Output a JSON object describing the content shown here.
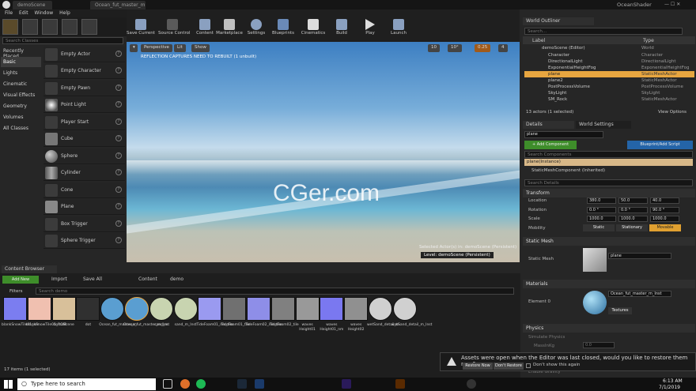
{
  "window": {
    "tabs": [
      "demoScene",
      "Ocean_fut_master_m"
    ],
    "app_name": "OceanShader"
  },
  "menu": [
    "File",
    "Edit",
    "Window",
    "Help"
  ],
  "modes": {
    "search_placeholder": "Search Classes",
    "categories": [
      "Recently Placed",
      "Basic",
      "Lights",
      "Cinematic",
      "Visual Effects",
      "Geometry",
      "Volumes",
      "All Classes"
    ],
    "selected": "Basic",
    "actors": [
      "Empty Actor",
      "Empty Character",
      "Empty Pawn",
      "Point Light",
      "Player Start",
      "Cube",
      "Sphere",
      "Cylinder",
      "Cone",
      "Plane",
      "Box Trigger",
      "Sphere Trigger"
    ]
  },
  "toolbar": [
    {
      "label": "Save Current",
      "icon": "save-icon"
    },
    {
      "label": "Source Control",
      "icon": "source-control-icon"
    },
    {
      "label": "Content",
      "icon": "content-icon"
    },
    {
      "label": "Marketplace",
      "icon": "marketplace-icon"
    },
    {
      "label": "Settings",
      "icon": "settings-icon"
    },
    {
      "label": "Blueprints",
      "icon": "blueprints-icon"
    },
    {
      "label": "Cinematics",
      "icon": "cinematics-icon"
    },
    {
      "label": "Build",
      "icon": "build-icon"
    },
    {
      "label": "Play",
      "icon": "play-icon"
    },
    {
      "label": "Launch",
      "icon": "launch-icon"
    }
  ],
  "viewport": {
    "perspective": "Perspective",
    "lit": "Lit",
    "show": "Show",
    "warning": "REFLECTION CAPTURES NEED TO REBUILT (1 unbuilt)",
    "snap": [
      "10",
      "10°",
      "0.25",
      "4"
    ],
    "selected_info": "Selected Actor(s) in: demoScene (Persistent)",
    "level": "Level: demoScene (Persistent)",
    "watermark": "CGer.com"
  },
  "outliner": {
    "title": "World Outliner",
    "search_placeholder": "Search...",
    "col_label": "Label",
    "col_type": "Type",
    "rows": [
      {
        "label": "demoScene (Editor)",
        "type": "World"
      },
      {
        "label": "Character",
        "type": "Character"
      },
      {
        "label": "DirectionalLight",
        "type": "DirectionalLight"
      },
      {
        "label": "ExponentialHeightFog",
        "type": "ExponentialHeightFog"
      },
      {
        "label": "plane",
        "type": "StaticMeshActor"
      },
      {
        "label": "plane2",
        "type": "StaticMeshActor"
      },
      {
        "label": "PostProcessVolume",
        "type": "PostProcessVolume"
      },
      {
        "label": "SkyLight",
        "type": "SkyLight"
      },
      {
        "label": "SM_Rock",
        "type": "StaticMeshActor"
      }
    ],
    "selected_index": 4,
    "count": "13 actors (1 selected)",
    "view_options": "View Options"
  },
  "details": {
    "tab1": "Details",
    "tab2": "World Settings",
    "name": "plane",
    "add_component": "+ Add Component",
    "blueprint": "Blueprint/Add Script",
    "search_components": "Search Components",
    "instance": "plane(Instance)",
    "component": "StaticMeshComponent (Inherited)",
    "search_details": "Search Details",
    "transform": {
      "title": "Transform",
      "location_label": "Location",
      "location": [
        "380.0",
        "50.0",
        "40.0"
      ],
      "rotation_label": "Rotation",
      "rotation": [
        "0.0 °",
        "0.0 °",
        "90.0 °"
      ],
      "scale_label": "Scale",
      "scale": [
        "1000.0",
        "1000.0",
        "1000.0"
      ],
      "mobility_label": "Mobility",
      "mobility": [
        "Static",
        "Stationary",
        "Movable"
      ]
    },
    "static_mesh": {
      "title": "Static Mesh",
      "label": "Static Mesh",
      "value": "plane"
    },
    "materials": {
      "title": "Materials",
      "element": "Element 0",
      "value": "Ocean_fut_master_m_Inst",
      "textures": "Textures"
    },
    "physics": {
      "title": "Physics",
      "simulate": "Simulate Physics",
      "mass": "MassInKg",
      "mass_value": "0.0",
      "gravity": "Enable Gravity"
    }
  },
  "content_browser": {
    "title": "Content Browser",
    "add_new": "Add New",
    "import": "Import",
    "save_all": "Save All",
    "path": [
      "Content",
      "demo"
    ],
    "filters": "Filters",
    "search_placeholder": "Search demo",
    "status": "17 items (1 selected)",
    "assets": [
      {
        "label": "blankSnowTile01_nm",
        "color": "#7b7df0"
      },
      {
        "label": "blankSnowTile01_ROM",
        "color": "#f0c0b0"
      },
      {
        "label": "demoScene",
        "color": "#d8c09a"
      },
      {
        "label": "dot",
        "color": "#303030"
      },
      {
        "label": "Ocean_fut_master_m",
        "color": "#5a9ed1"
      },
      {
        "label": "Ocean_fut_master_m_Inst",
        "color": "#5a9ed1"
      },
      {
        "label": "sand_m",
        "color": "#c8d4b0"
      },
      {
        "label": "sand_m_Inst",
        "color": "#c8d4b0"
      },
      {
        "label": "TideFoam01_nm_tile",
        "color": "#9a9af0"
      },
      {
        "label": "TideFoam01_tile",
        "color": "#707070"
      },
      {
        "label": "TideFoam02_nm_tile",
        "color": "#8e8ee8"
      },
      {
        "label": "TideFoam02_tile",
        "color": "#808080"
      },
      {
        "label": "waves Height01",
        "color": "#999999"
      },
      {
        "label": "waves Height01_nm",
        "color": "#7a78f0"
      },
      {
        "label": "waves Height02",
        "color": "#909090"
      },
      {
        "label": "wetSand_detail_m",
        "color": "#d0d0d0"
      },
      {
        "label": "wetSand_detail_m_Inst",
        "color": "#d0d0d0"
      }
    ]
  },
  "notification": {
    "message": "Assets were open when the Editor was last closed, would you like to restore them now?",
    "restore": "Restore Now",
    "dont": "Don't Restore",
    "dont_show": "Don't show this again"
  },
  "taskbar": {
    "search": "Type here to search",
    "time": "6:13 AM",
    "date": "7/1/2019"
  }
}
